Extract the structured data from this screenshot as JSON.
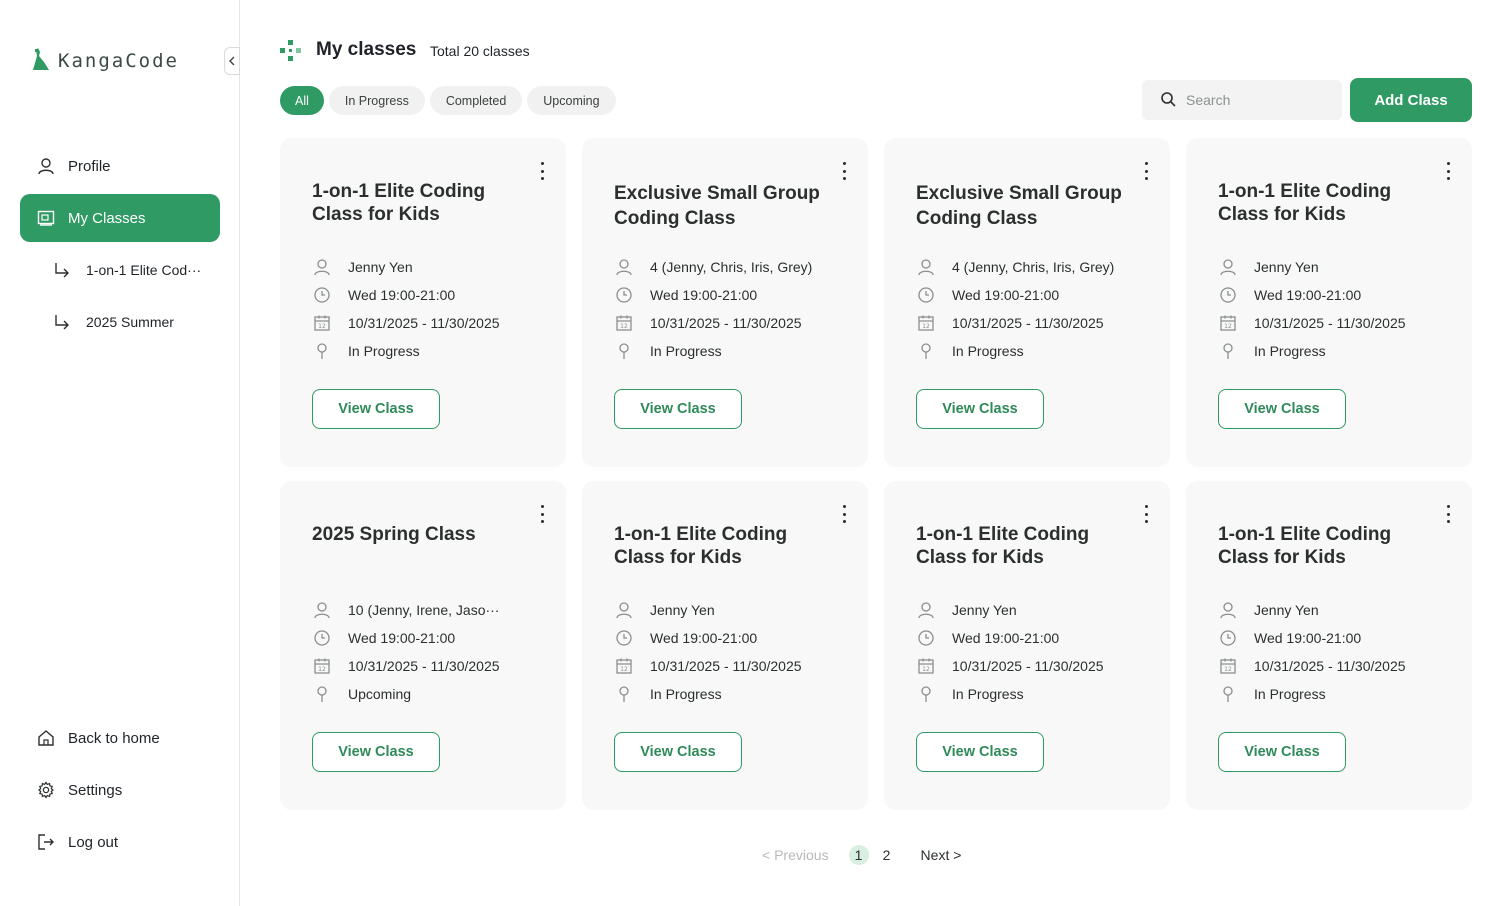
{
  "app": {
    "logo_text": "KangaCode",
    "brand_color": "#2f9a63"
  },
  "sidebar": {
    "items": [
      {
        "label": "Profile",
        "icon": "user-icon"
      },
      {
        "label": "My Classes",
        "icon": "classroom-icon",
        "active": true
      }
    ],
    "sub_items": [
      {
        "label": "1-on-1 Elite Cod···",
        "icon": "subdirectory-arrow-icon"
      },
      {
        "label": "2025 Summer",
        "icon": "subdirectory-arrow-icon"
      }
    ],
    "bottom_items": [
      {
        "label": "Back to home",
        "icon": "home-icon"
      },
      {
        "label": "Settings",
        "icon": "gear-icon"
      },
      {
        "label": "Log out",
        "icon": "logout-icon"
      }
    ]
  },
  "header": {
    "title": "My classes",
    "total": "Total 20 classes"
  },
  "filters": [
    "All",
    "In Progress",
    "Completed",
    "Upcoming"
  ],
  "search": {
    "placeholder": "Search"
  },
  "add_button": "Add Class",
  "cards": [
    {
      "title": "1-on-1 Elite Coding Class for Kids",
      "students": "Jenny Yen",
      "schedule": "Wed 19:00-21:00",
      "dates": "10/31/2025 - 11/30/2025",
      "status": "In Progress",
      "button": "View Class"
    },
    {
      "title": "Exclusive Small Group Coding Class",
      "students": "4 (Jenny, Chris, Iris, Grey)",
      "schedule": "Wed 19:00-21:00",
      "dates": "10/31/2025 - 11/30/2025",
      "status": "In Progress",
      "button": "View Class"
    },
    {
      "title": "Exclusive Small Group Coding Class",
      "students": "4 (Jenny, Chris, Iris, Grey)",
      "schedule": "Wed 19:00-21:00",
      "dates": "10/31/2025 - 11/30/2025",
      "status": "In Progress",
      "button": "View Class"
    },
    {
      "title": "1-on-1 Elite Coding Class for Kids",
      "students": "Jenny Yen",
      "schedule": "Wed 19:00-21:00",
      "dates": "10/31/2025 - 11/30/2025",
      "status": "In Progress",
      "button": "View Class"
    },
    {
      "title": "2025 Spring Class",
      "students": "10 (Jenny, Irene, Jaso···",
      "schedule": "Wed 19:00-21:00",
      "dates": "10/31/2025 - 11/30/2025",
      "status": "Upcoming",
      "button": "View Class"
    },
    {
      "title": "1-on-1 Elite Coding Class for Kids",
      "students": "Jenny Yen",
      "schedule": "Wed 19:00-21:00",
      "dates": "10/31/2025 - 11/30/2025",
      "status": "In Progress",
      "button": "View Class"
    },
    {
      "title": "1-on-1 Elite Coding Class for Kids",
      "students": "Jenny Yen",
      "schedule": "Wed 19:00-21:00",
      "dates": "10/31/2025 - 11/30/2025",
      "status": "In Progress",
      "button": "View Class"
    },
    {
      "title": "1-on-1 Elite Coding Class for Kids",
      "students": "Jenny Yen",
      "schedule": "Wed 19:00-21:00",
      "dates": "10/31/2025 - 11/30/2025",
      "status": "In Progress",
      "button": "View Class"
    }
  ],
  "pagination": {
    "previous": "< Previous",
    "pages": [
      "1",
      "2"
    ],
    "current": "1",
    "next": "Next >"
  }
}
